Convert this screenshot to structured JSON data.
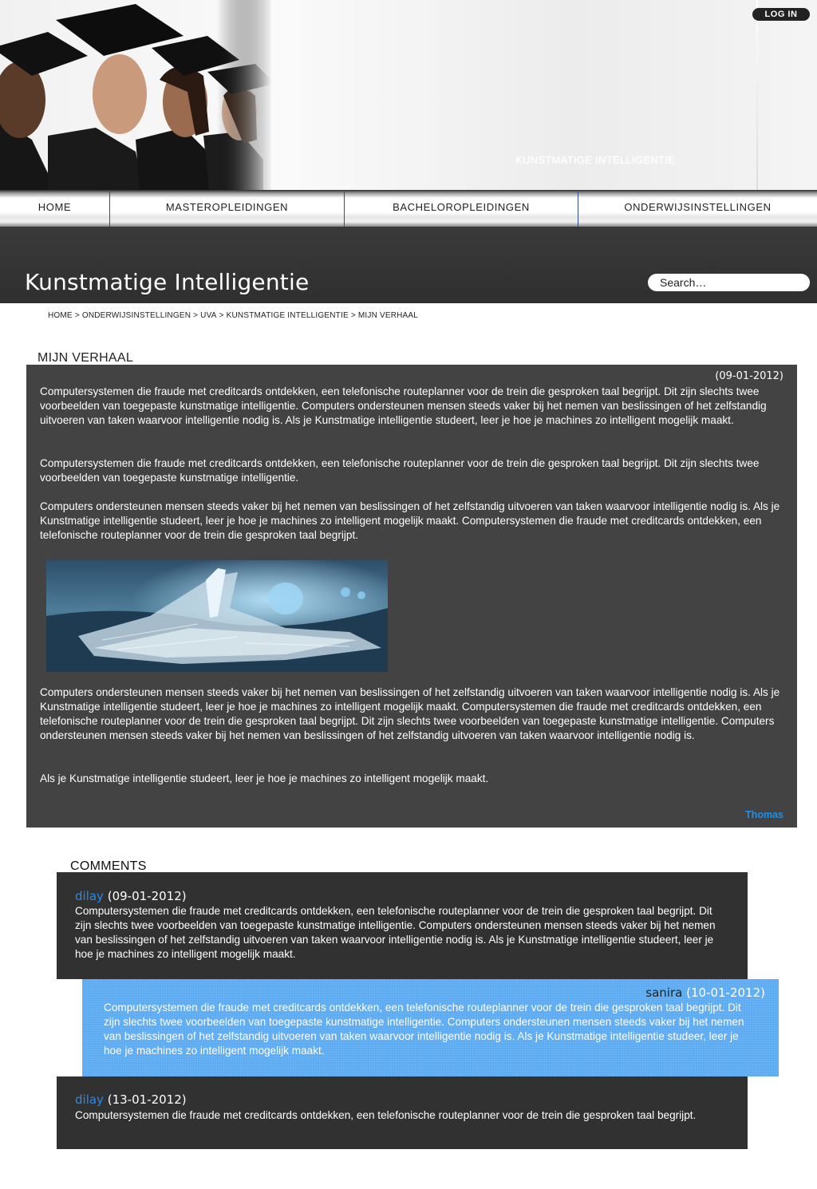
{
  "header": {
    "login_label": "LOG IN",
    "site_tagline": "KUNSTMATIGE INTELLIGENTIE"
  },
  "nav": {
    "items": [
      {
        "label": "HOME"
      },
      {
        "label": "MASTEROPLEIDINGEN"
      },
      {
        "label": "BACHELOROPLEIDINGEN"
      },
      {
        "label": "ONDERWIJSINSTELLINGEN"
      }
    ]
  },
  "page": {
    "title": "Kunstmatige Intelligentie"
  },
  "search": {
    "placeholder": "Search…"
  },
  "breadcrumb": {
    "items": [
      "HOME",
      "ONDERWIJSINSTELLINGEN",
      "UVA",
      "KUNSTMATIGE INTELLIGENTIE",
      "MIJN VERHAAL"
    ],
    "separator": ">"
  },
  "story": {
    "heading": "MIJN VERHAAL",
    "date": "(09-01-2012)",
    "paragraphs": [
      "Computersystemen die fraude met creditcards ontdekken, een telefonische routeplanner voor de trein die gesproken taal begrijpt. Dit zijn slechts twee voorbeelden van toegepaste kunstmatige intelligentie. Computers ondersteunen mensen steeds vaker bij het nemen van beslissingen of het zelfstandig uitvoeren van taken waarvoor intelligentie nodig is. Als je Kunstmatige intelligentie studeert, leer je hoe je machines zo intelligent mogelijk maakt.",
      "Computersystemen die fraude met creditcards ontdekken, een telefonische routeplanner voor de trein die gesproken taal begrijpt. Dit zijn slechts twee voorbeelden van toegepaste kunstmatige intelligentie.",
      "Computers ondersteunen mensen steeds vaker bij het nemen van beslissingen of het zelfstandig uitvoeren van taken waarvoor intelligentie nodig is. Als je Kunstmatige intelligentie studeert, leer je hoe je machines zo intelligent mogelijk maakt. Computersystemen die fraude met creditcards ontdekken, een telefonische routeplanner voor de trein die gesproken taal begrijpt.",
      " Computers ondersteunen mensen steeds vaker bij het nemen van beslissingen of het zelfstandig uitvoeren van taken waarvoor intelligentie nodig is. Als je Kunstmatige intelligentie studeert, leer je hoe je machines zo intelligent mogelijk maakt. Computersystemen die fraude met creditcards ontdekken, een telefonische routeplanner voor de trein die gesproken taal begrijpt. Dit zijn slechts twee voorbeelden van toegepaste kunstmatige intelligentie. Computers ondersteunen mensen steeds vaker bij het nemen van beslissingen of het zelfstandig uitvoeren van taken waarvoor intelligentie nodig is.",
      "Als je Kunstmatige intelligentie studeert, leer je hoe je machines zo intelligent mogelijk maakt."
    ],
    "author": "Thomas"
  },
  "comments": {
    "heading": "COMMENTS",
    "items": [
      {
        "user": "dilay",
        "date": "(09-01-2012)",
        "text": "Computersystemen die fraude met creditcards ontdekken, een telefonische routeplanner voor de trein die gesproken taal begrijpt. Dit zijn slechts twee voorbeelden van toegepaste kunstmatige intelligentie. Computers ondersteunen mensen steeds vaker bij het nemen van beslissingen of het zelfstandig uitvoeren van taken waarvoor intelligentie nodig is. Als je Kunstmatige intelligentie studeert, leer je hoe je machines zo intelligent mogelijk maakt."
      },
      {
        "user": "sanira",
        "date": "(10-01-2012)",
        "text": "Computersystemen die fraude met creditcards ontdekken, een telefonische routeplanner voor de trein die gesproken taal begrijpt. Dit zijn slechts twee voorbeelden van toegepaste kunstmatige intelligentie. Computers ondersteunen mensen steeds vaker bij het nemen van beslissingen of het zelfstandig uitvoeren van taken waarvoor intelligentie nodig is. Als je Kunstmatige intelligentie studeer, leer je hoe je machines zo intelligent mogelijk maakt."
      },
      {
        "user": "dilay",
        "date": "(13-01-2012)",
        "text": "Computersystemen die fraude met creditcards ontdekken, een telefonische routeplanner voor de trein die gesproken taal begrijpt."
      }
    ]
  },
  "colors": {
    "story_bg": "#434343",
    "comment_dark_bg": "#313131",
    "comment_reply_bg": "#5aaaf2",
    "accent_link": "#1e90e6",
    "nav_separator": "#2e4f88"
  }
}
